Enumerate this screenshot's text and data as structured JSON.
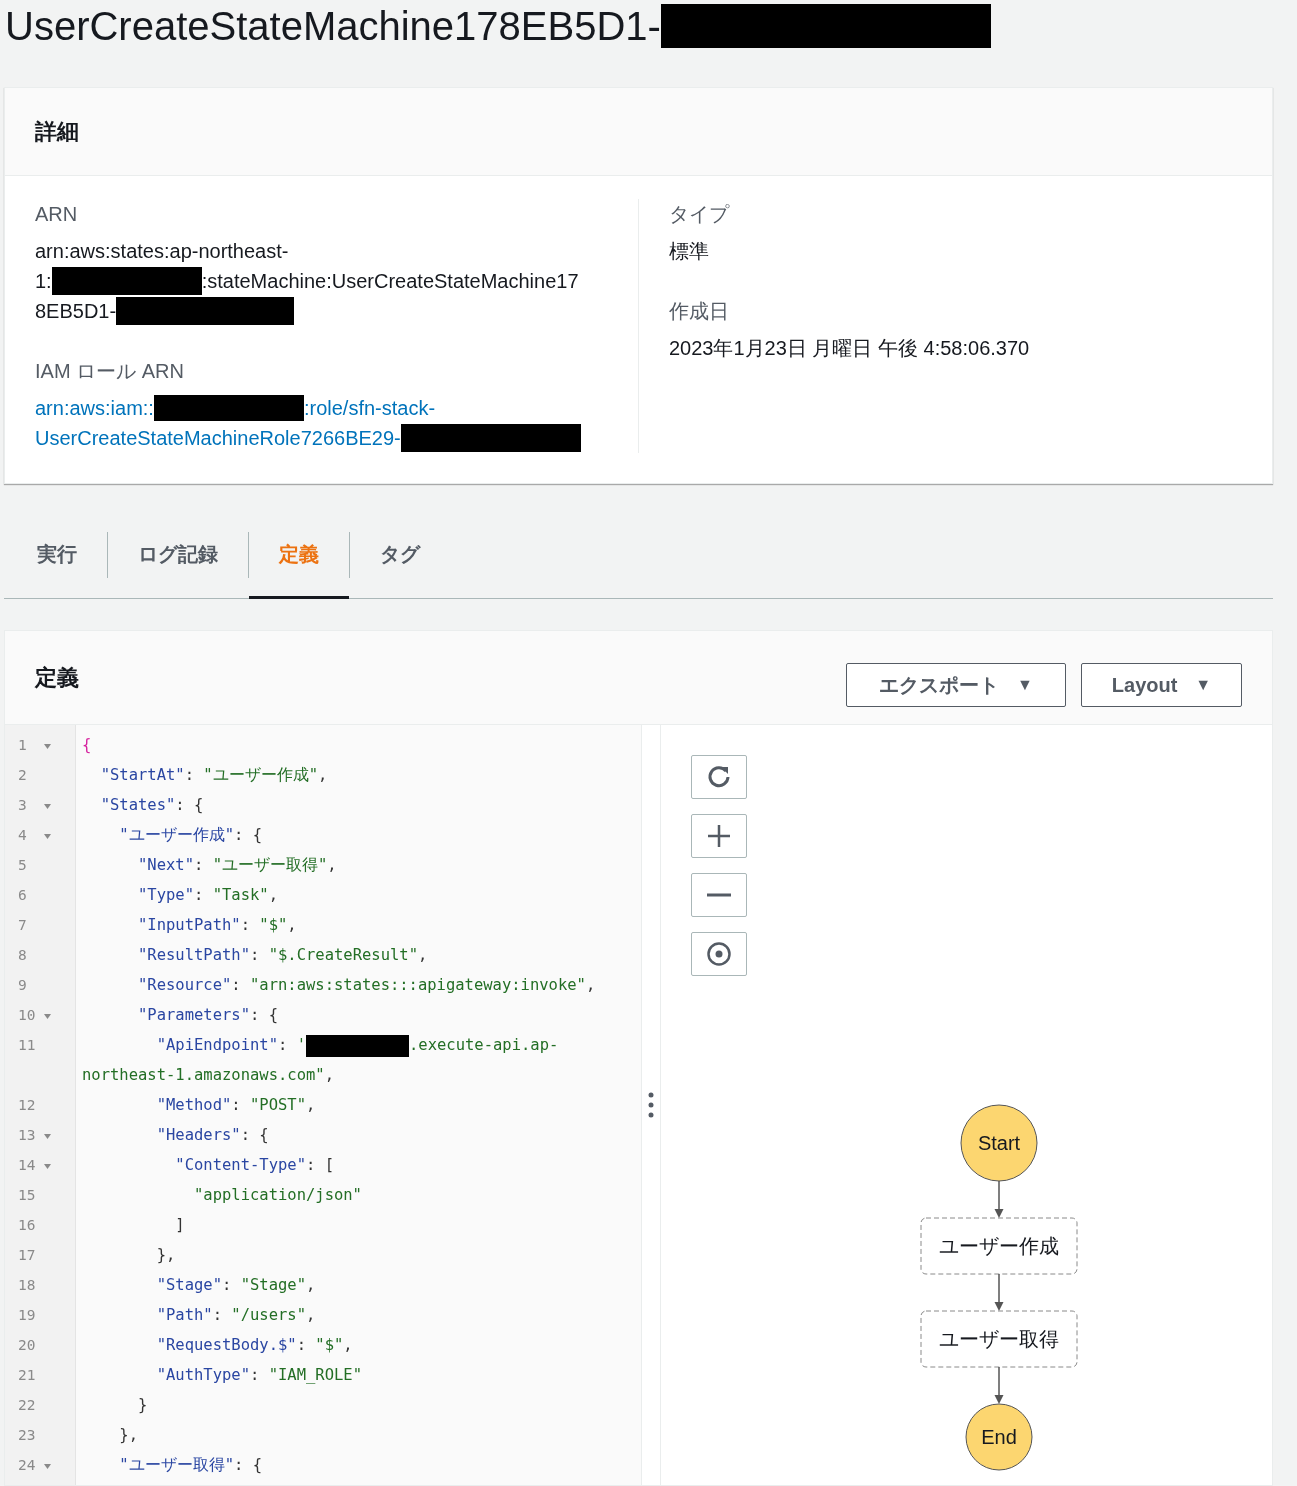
{
  "title": [
    {
      "kind": "text",
      "text": "UserCreateStateMachine178EB5D1-"
    },
    {
      "kind": "redacted"
    }
  ],
  "details": {
    "heading": "詳細",
    "left": [
      {
        "label": "ARN",
        "kind": "plain",
        "lines": [
          [
            {
              "kind": "text",
              "text": "arn:aws:states:ap-northeast-"
            }
          ],
          [
            {
              "kind": "text",
              "text": "1:"
            },
            {
              "kind": "redacted"
            },
            {
              "kind": "text",
              "text": ":stateMachine:UserCreateStateMachine17"
            }
          ],
          [
            {
              "kind": "text",
              "text": "8EB5D1-"
            },
            {
              "kind": "redacted"
            }
          ]
        ]
      },
      {
        "label": "IAM ロール ARN",
        "kind": "link",
        "lines": [
          [
            {
              "kind": "text",
              "text": "arn:aws:iam::"
            },
            {
              "kind": "redacted"
            },
            {
              "kind": "text",
              "text": ":role/sfn-stack-"
            }
          ],
          [
            {
              "kind": "text",
              "text": "UserCreateStateMachineRole7266BE29-"
            },
            {
              "kind": "redacted"
            }
          ]
        ]
      }
    ],
    "right": [
      {
        "label": "タイプ",
        "kind": "plain",
        "lines": [
          [
            {
              "kind": "text",
              "text": "標準"
            }
          ]
        ]
      },
      {
        "label": "作成日",
        "kind": "plain",
        "lines": [
          [
            {
              "kind": "text",
              "text": "2023年1月23日 月曜日 午後 4:58:06.370"
            }
          ]
        ]
      }
    ]
  },
  "tabs": [
    {
      "label": "実行",
      "selected": false
    },
    {
      "label": "ログ記録",
      "selected": false
    },
    {
      "label": "定義",
      "selected": true
    },
    {
      "label": "タグ",
      "selected": false
    }
  ],
  "definition": {
    "heading": "定義",
    "buttons": [
      {
        "label": "エクスポート",
        "caret": "▼"
      },
      {
        "label": "Layout",
        "caret": "▼"
      }
    ],
    "code": [
      {
        "number": "1",
        "foldable": true,
        "tokens": [
          {
            "kind": "brace",
            "text": "{"
          }
        ]
      },
      {
        "number": "2",
        "foldable": false,
        "tokens": [
          {
            "kind": "key",
            "text": "  \"StartAt\""
          },
          {
            "kind": "punct",
            "text": ": "
          },
          {
            "kind": "string",
            "text": "\"ユーザー作成\""
          },
          {
            "kind": "punct",
            "text": ","
          }
        ]
      },
      {
        "number": "3",
        "foldable": true,
        "tokens": [
          {
            "kind": "key",
            "text": "  \"States\""
          },
          {
            "kind": "punct",
            "text": ": {"
          }
        ]
      },
      {
        "number": "4",
        "foldable": true,
        "tokens": [
          {
            "kind": "key",
            "text": "    \"ユーザー作成\""
          },
          {
            "kind": "punct",
            "text": ": {"
          }
        ]
      },
      {
        "number": "5",
        "foldable": false,
        "tokens": [
          {
            "kind": "key",
            "text": "      \"Next\""
          },
          {
            "kind": "punct",
            "text": ": "
          },
          {
            "kind": "string",
            "text": "\"ユーザー取得\""
          },
          {
            "kind": "punct",
            "text": ","
          }
        ]
      },
      {
        "number": "6",
        "foldable": false,
        "tokens": [
          {
            "kind": "key",
            "text": "      \"Type\""
          },
          {
            "kind": "punct",
            "text": ": "
          },
          {
            "kind": "string",
            "text": "\"Task\""
          },
          {
            "kind": "punct",
            "text": ","
          }
        ]
      },
      {
        "number": "7",
        "foldable": false,
        "tokens": [
          {
            "kind": "key",
            "text": "      \"InputPath\""
          },
          {
            "kind": "punct",
            "text": ": "
          },
          {
            "kind": "string",
            "text": "\"$\""
          },
          {
            "kind": "punct",
            "text": ","
          }
        ]
      },
      {
        "number": "8",
        "foldable": false,
        "tokens": [
          {
            "kind": "key",
            "text": "      \"ResultPath\""
          },
          {
            "kind": "punct",
            "text": ": "
          },
          {
            "kind": "string",
            "text": "\"$.CreateResult\""
          },
          {
            "kind": "punct",
            "text": ","
          }
        ]
      },
      {
        "number": "9",
        "foldable": false,
        "tokens": [
          {
            "kind": "key",
            "text": "      \"Resource\""
          },
          {
            "kind": "punct",
            "text": ": "
          },
          {
            "kind": "string",
            "text": "\"arn:aws:states:::apigateway:invoke\""
          },
          {
            "kind": "punct",
            "text": ","
          }
        ]
      },
      {
        "number": "10",
        "foldable": true,
        "tokens": [
          {
            "kind": "key",
            "text": "      \"Parameters\""
          },
          {
            "kind": "punct",
            "text": ": {"
          }
        ]
      },
      {
        "number": "11",
        "foldable": false,
        "tokens": [
          {
            "kind": "key",
            "text": "        \"ApiEndpoint\""
          },
          {
            "kind": "punct",
            "text": ": "
          },
          {
            "kind": "string",
            "text": "'"
          },
          {
            "kind": "redacted"
          },
          {
            "kind": "string",
            "text": ".execute-api.ap-"
          }
        ],
        "continuation": [
          {
            "kind": "string",
            "text": "northeast-1.amazonaws.com\""
          },
          {
            "kind": "punct",
            "text": ","
          }
        ]
      },
      {
        "number": "12",
        "foldable": false,
        "tokens": [
          {
            "kind": "key",
            "text": "        \"Method\""
          },
          {
            "kind": "punct",
            "text": ": "
          },
          {
            "kind": "string",
            "text": "\"POST\""
          },
          {
            "kind": "punct",
            "text": ","
          }
        ]
      },
      {
        "number": "13",
        "foldable": true,
        "tokens": [
          {
            "kind": "key",
            "text": "        \"Headers\""
          },
          {
            "kind": "punct",
            "text": ": {"
          }
        ]
      },
      {
        "number": "14",
        "foldable": true,
        "tokens": [
          {
            "kind": "key",
            "text": "          \"Content-Type\""
          },
          {
            "kind": "punct",
            "text": ": ["
          }
        ]
      },
      {
        "number": "15",
        "foldable": false,
        "tokens": [
          {
            "kind": "string",
            "text": "            \"application/json\""
          }
        ]
      },
      {
        "number": "16",
        "foldable": false,
        "tokens": [
          {
            "kind": "punct",
            "text": "          ]"
          }
        ]
      },
      {
        "number": "17",
        "foldable": false,
        "tokens": [
          {
            "kind": "punct",
            "text": "        },"
          }
        ]
      },
      {
        "number": "18",
        "foldable": false,
        "tokens": [
          {
            "kind": "key",
            "text": "        \"Stage\""
          },
          {
            "kind": "punct",
            "text": ": "
          },
          {
            "kind": "string",
            "text": "\"Stage\""
          },
          {
            "kind": "punct",
            "text": ","
          }
        ]
      },
      {
        "number": "19",
        "foldable": false,
        "tokens": [
          {
            "kind": "key",
            "text": "        \"Path\""
          },
          {
            "kind": "punct",
            "text": ": "
          },
          {
            "kind": "string",
            "text": "\"/users\""
          },
          {
            "kind": "punct",
            "text": ","
          }
        ]
      },
      {
        "number": "20",
        "foldable": false,
        "tokens": [
          {
            "kind": "key",
            "text": "        \"RequestBody.$\""
          },
          {
            "kind": "punct",
            "text": ": "
          },
          {
            "kind": "string",
            "text": "\"$\""
          },
          {
            "kind": "punct",
            "text": ","
          }
        ]
      },
      {
        "number": "21",
        "foldable": false,
        "tokens": [
          {
            "kind": "key",
            "text": "        \"AuthType\""
          },
          {
            "kind": "punct",
            "text": ": "
          },
          {
            "kind": "string",
            "text": "\"IAM_ROLE\""
          }
        ]
      },
      {
        "number": "22",
        "foldable": false,
        "tokens": [
          {
            "kind": "punct",
            "text": "      }"
          }
        ]
      },
      {
        "number": "23",
        "foldable": false,
        "tokens": [
          {
            "kind": "punct",
            "text": "    },"
          }
        ]
      },
      {
        "number": "24",
        "foldable": true,
        "tokens": [
          {
            "kind": "key",
            "text": "    \"ユーザー取得\""
          },
          {
            "kind": "punct",
            "text": ": {"
          }
        ]
      }
    ],
    "graph": {
      "nodes": [
        {
          "kind": "start",
          "label": "Start"
        },
        {
          "kind": "task",
          "label": "ユーザー作成"
        },
        {
          "kind": "task",
          "label": "ユーザー取得"
        },
        {
          "kind": "end",
          "label": "End"
        }
      ]
    }
  }
}
